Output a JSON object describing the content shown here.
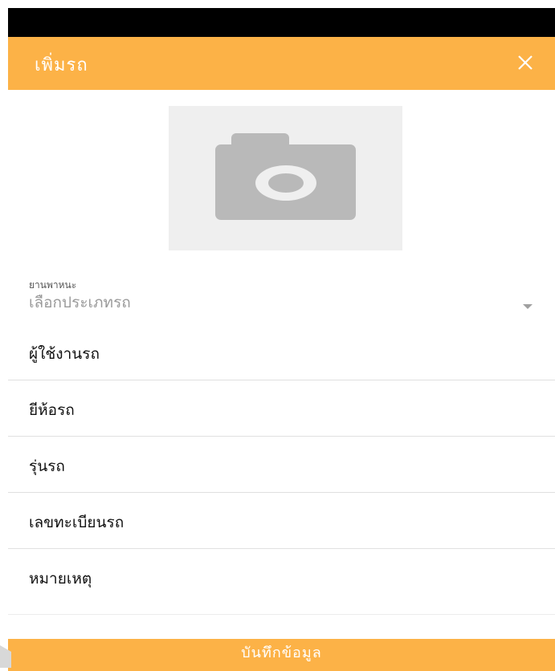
{
  "header": {
    "title": "เพิ่มรถ",
    "close_icon": "close-icon"
  },
  "photo": {
    "icon": "camera-icon"
  },
  "vehicle_type": {
    "label": "ยานพาหนะ",
    "placeholder": "เลือกประเภทรถ",
    "icon": "chevron-down-icon"
  },
  "fields": [
    {
      "label": "ผู้ใช้งานรถ"
    },
    {
      "label": "ยีห้อรถ"
    },
    {
      "label": "รุ่นรถ"
    },
    {
      "label": "เลขทะเบียนรถ"
    },
    {
      "label": "หมายเหตุ"
    }
  ],
  "save_button": {
    "label": "บันทึกข้อมูล"
  },
  "colors": {
    "accent": "#fcb247",
    "statusbar": "#000000",
    "photo_bg": "#efefef"
  }
}
